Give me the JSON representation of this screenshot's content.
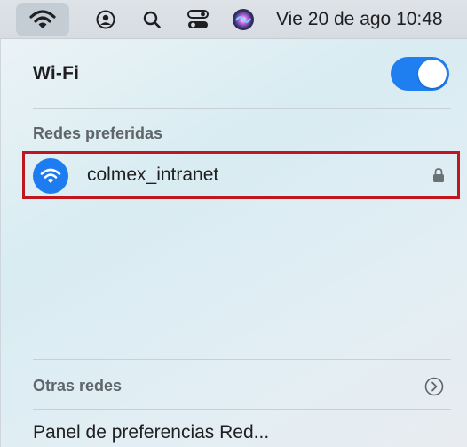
{
  "menubar": {
    "icons": [
      "wifi-icon",
      "user-circle-icon",
      "search-icon",
      "control-center-icon",
      "siri-icon"
    ],
    "datetime": "Vie 20 de ago  10:48"
  },
  "wifi_panel": {
    "title": "Wi-Fi",
    "toggle_on": true,
    "preferred_label": "Redes preferidas",
    "preferred_networks": [
      {
        "name": "colmex_intranet",
        "secured": true
      }
    ],
    "other_networks_label": "Otras redes",
    "preferences_link": "Panel de preferencias Red..."
  },
  "colors": {
    "accent": "#1f7ef0",
    "highlight_border": "#c0161f"
  }
}
